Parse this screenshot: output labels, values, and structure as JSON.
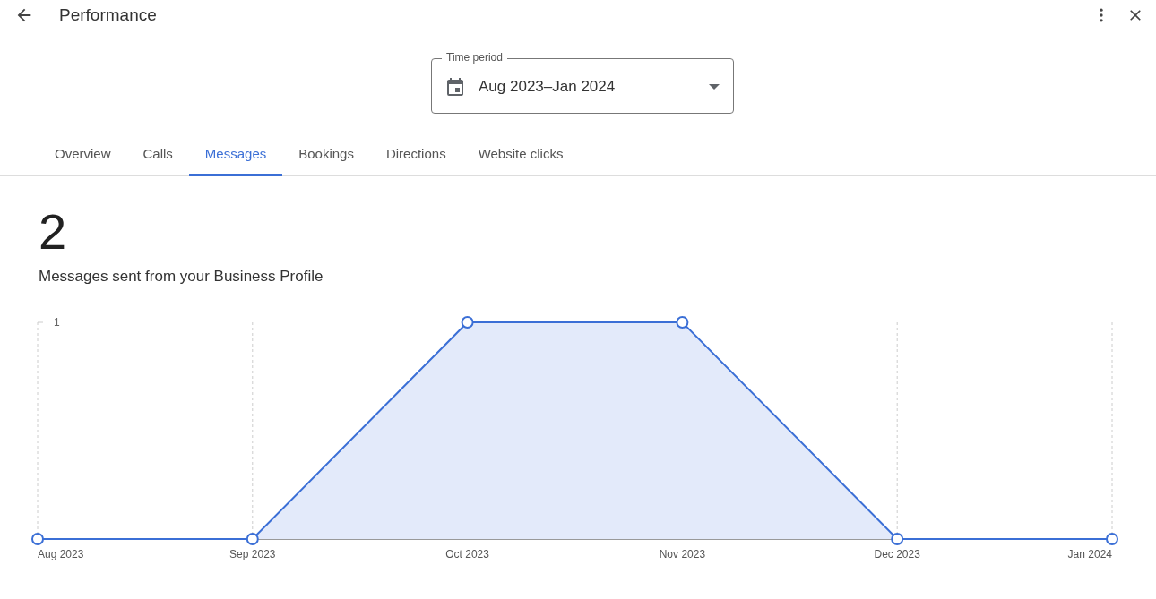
{
  "header": {
    "title": "Performance"
  },
  "time_period": {
    "label": "Time period",
    "value": "Aug 2023–Jan 2024"
  },
  "tabs": [
    {
      "label": "Overview",
      "selected": false
    },
    {
      "label": "Calls",
      "selected": false
    },
    {
      "label": "Messages",
      "selected": true
    },
    {
      "label": "Bookings",
      "selected": false
    },
    {
      "label": "Directions",
      "selected": false
    },
    {
      "label": "Website clicks",
      "selected": false
    }
  ],
  "metric": {
    "value": "2",
    "caption": "Messages sent from your Business Profile"
  },
  "chart_data": {
    "type": "area",
    "categories": [
      "Aug 2023",
      "Sep 2023",
      "Oct 2023",
      "Nov 2023",
      "Dec 2023",
      "Jan 2024"
    ],
    "values": [
      0,
      0,
      1,
      1,
      0,
      0
    ],
    "ylim": [
      0,
      1
    ],
    "yticks": [
      1
    ]
  }
}
